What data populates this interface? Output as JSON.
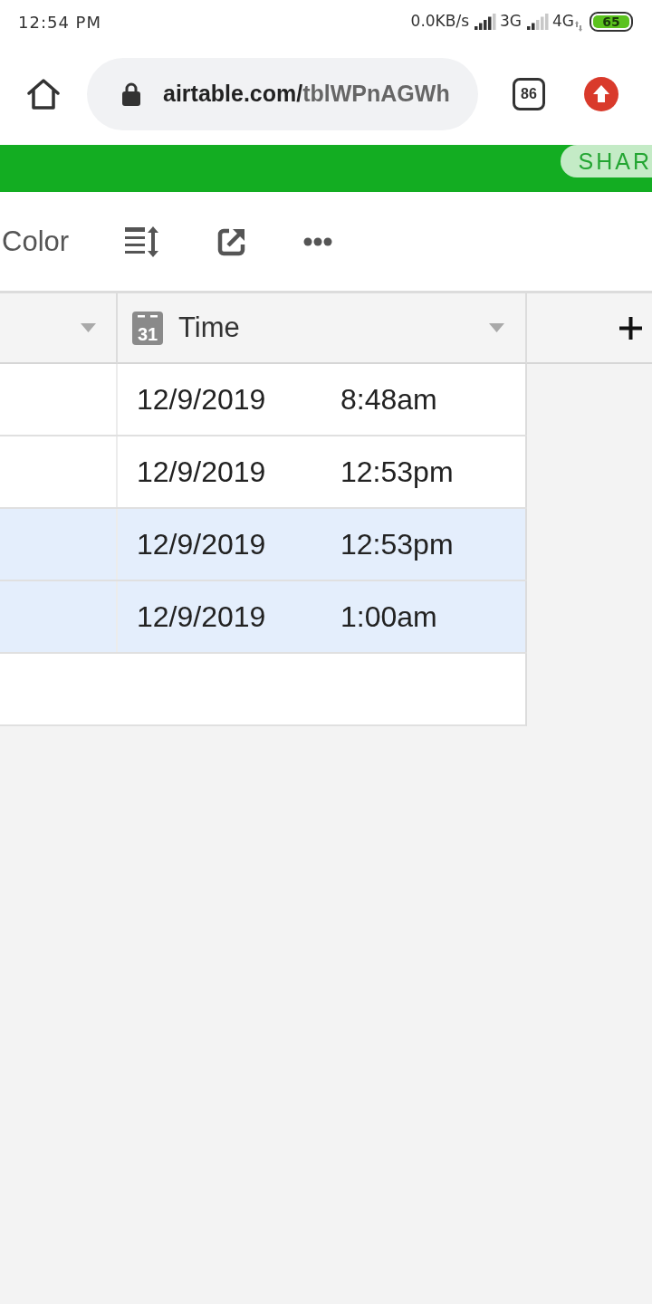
{
  "status_bar": {
    "time": "12:54 PM",
    "network_speed": "0.0KB/s",
    "networks": [
      "3G",
      "4G"
    ],
    "battery": "65"
  },
  "browser": {
    "url_host": "airtable.com/",
    "url_path": "tblWPnAGWh",
    "tab_count": "86"
  },
  "header_bar": {
    "share_button": "SHAR"
  },
  "toolbar": {
    "color_button": "Color"
  },
  "table": {
    "columns": [
      {
        "kind": "blank"
      },
      {
        "kind": "date",
        "icon_text": "31",
        "label": "Time"
      }
    ],
    "rows": [
      {
        "date": "12/9/2019",
        "time": "8:48am",
        "selected": false
      },
      {
        "date": "12/9/2019",
        "time": "12:53pm",
        "selected": false
      },
      {
        "date": "12/9/2019",
        "time": "12:53pm",
        "selected": true
      },
      {
        "date": "12/9/2019",
        "time": "1:00am",
        "selected": true
      }
    ]
  }
}
